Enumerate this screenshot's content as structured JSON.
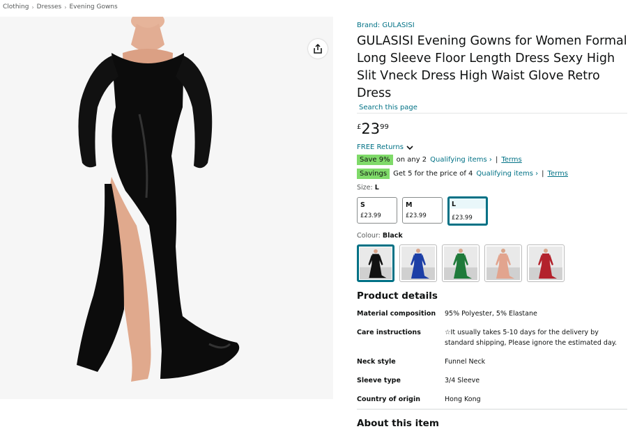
{
  "breadcrumb": [
    "Clothing",
    "Dresses",
    "Evening Gowns"
  ],
  "product": {
    "brand": "Brand: GULASISI",
    "title": "GULASISI Evening Gowns for Women Formal Long Sleeve Floor Length Dress Sexy High Slit Vneck Dress High Waist Glove Retro Dress",
    "search_link": "Search this page"
  },
  "price": {
    "currency": "£",
    "whole": "23",
    "fraction": "99"
  },
  "returns_label": "FREE Returns",
  "promos": [
    {
      "badge": "Save 9%",
      "text": "on any 2",
      "link": "Qualifying items ›",
      "terms": "Terms"
    },
    {
      "badge": "Savings",
      "text": "Get 5 for the price of 4",
      "link": "Qualifying items ›",
      "terms": "Terms"
    }
  ],
  "size": {
    "label": "Size:",
    "selected": "L",
    "options": [
      {
        "name": "S",
        "price": "£23.99"
      },
      {
        "name": "M",
        "price": "£23.99"
      },
      {
        "name": "L",
        "price": "£23.99"
      }
    ]
  },
  "colour": {
    "label": "Colour:",
    "selected": "Black",
    "swatch_colors": [
      "#111111",
      "#1d3fa6",
      "#1f7a3a",
      "#e2a48e",
      "#b3222c"
    ]
  },
  "details": {
    "heading": "Product details",
    "rows": [
      {
        "key": "Material composition",
        "value": "95% Polyester, 5% Elastane"
      },
      {
        "key": "Care instructions",
        "value": "☆It usually takes 5-10 days for the delivery by standard shipping, Please ignore the estimated day."
      },
      {
        "key": "Neck style",
        "value": "Funnel Neck"
      },
      {
        "key": "Sleeve type",
        "value": "3/4 Sleeve"
      },
      {
        "key": "Country of origin",
        "value": "Hong Kong"
      }
    ]
  },
  "about_heading": "About this item"
}
